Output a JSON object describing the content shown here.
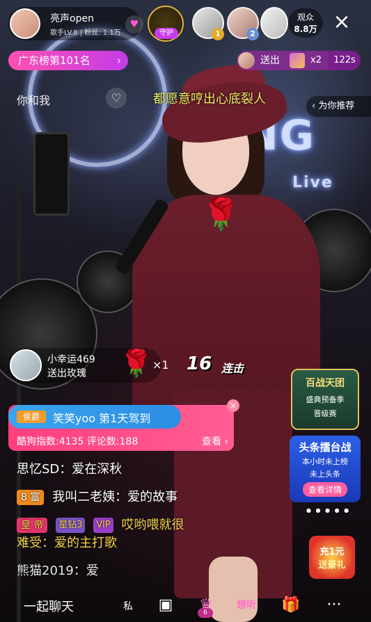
{
  "host": {
    "name": "亮声open",
    "meta": "歌手LV.8 | 粉丝: 1.1万",
    "follow_icon": "heart-icon"
  },
  "guard": {
    "label": "守护"
  },
  "top_viewers": [
    {
      "rank": "1",
      "rank_color": "#e7a927"
    },
    {
      "rank": "2",
      "rank_color": "#6b8fd6"
    }
  ],
  "viewers": {
    "label": "观众",
    "count": "8.8万"
  },
  "rank_pill": {
    "label": "广东榜第101名",
    "chevron": "›"
  },
  "gift_top": {
    "action": "送出",
    "count": "x2",
    "time": "122s"
  },
  "song": {
    "name": "你和我",
    "lyric": "都愿意哼出心底裂人"
  },
  "recommend": {
    "label": "‹ 为你推荐"
  },
  "gift_combo": {
    "sender": "小幸运469",
    "action": "送出玫瑰",
    "multiplier": "×1",
    "combo_count": "16",
    "combo_label": "连击"
  },
  "member": {
    "tag": "侯爵",
    "text": "笑笑yoo 第1天驾到",
    "stats": "酷狗指数:4135  评论数:188",
    "more": "查看 ›"
  },
  "chat": [
    {
      "text": "思忆SD：爱在深秋"
    },
    {
      "tag": "8 富",
      "text": "我叫二老姨：爱的故事"
    },
    {
      "tag": "皇 帝",
      "star": "星钻3",
      "vip": "VIP",
      "text": "哎哟喂就很"
    },
    {
      "text": "难受：爱的主打歌"
    },
    {
      "text": "熊猫2019：爱"
    }
  ],
  "promo1": {
    "title": "百战天团",
    "sub": "盛典预备季",
    "stage": "晋级赛"
  },
  "promo2": {
    "title": "头条擂台战",
    "line1": "本小时未上榜",
    "line2": "未上头条",
    "button": "查看详情"
  },
  "promo3": {
    "line1": "充1元",
    "line2": "送豪礼"
  },
  "bottom_bar": {
    "chat_label": "一起聊天",
    "private_label": "私",
    "gift_badge": "6",
    "listen_label": "想听",
    "more_label": "···"
  },
  "colors": {
    "accent_pink": "#ff4fb0",
    "lyric_yellow": "#e9ea60",
    "member_pink": "#ff3f7d",
    "member_blue": "#3aa5ef"
  }
}
